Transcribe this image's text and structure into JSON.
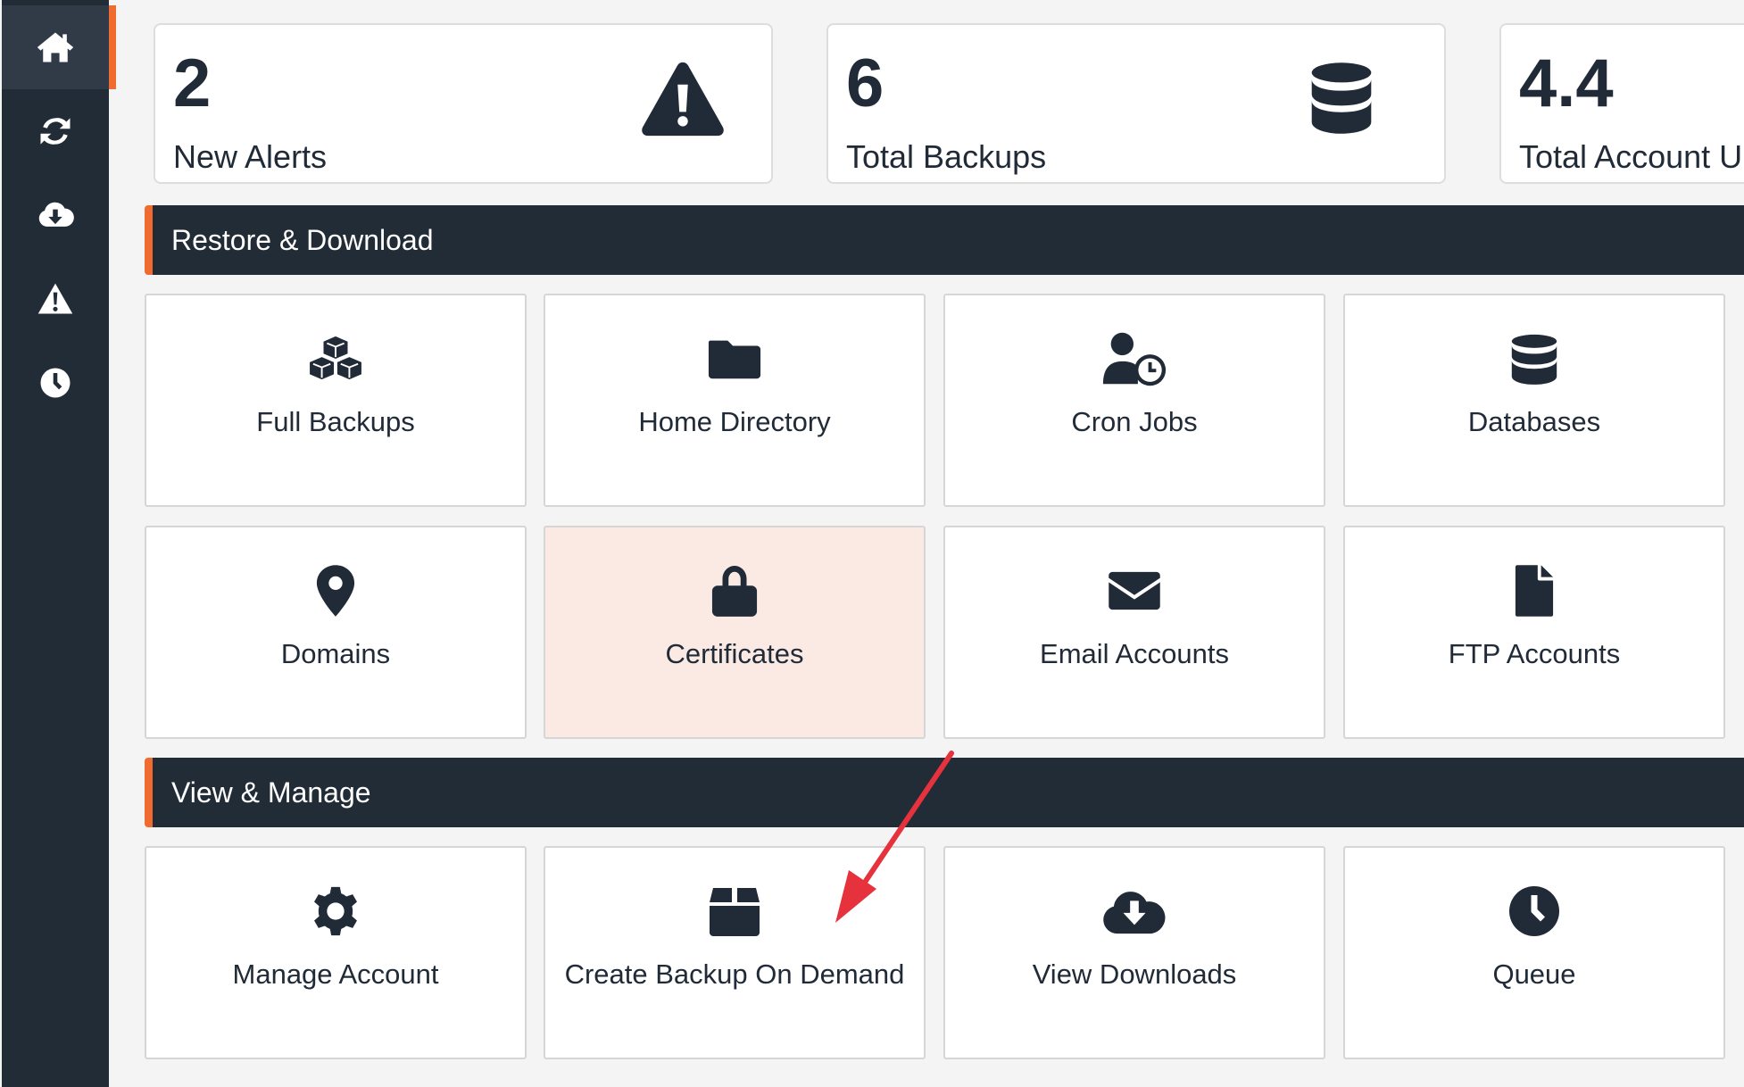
{
  "sidebar": {
    "items": [
      {
        "icon": "home-icon",
        "active": true
      },
      {
        "icon": "sync-icon",
        "active": false
      },
      {
        "icon": "cloud-download-icon",
        "active": false
      },
      {
        "icon": "warning-icon",
        "active": false
      },
      {
        "icon": "clock-icon",
        "active": false
      }
    ]
  },
  "stats": [
    {
      "value": "2",
      "label": "New Alerts",
      "icon": "warning-icon"
    },
    {
      "value": "6",
      "label": "Total Backups",
      "icon": "database-icon"
    },
    {
      "value": "4.4",
      "label": "Total Account U"
    }
  ],
  "sections": {
    "restore": {
      "title": "Restore & Download",
      "tiles": [
        {
          "label": "Full Backups",
          "icon": "cubes-icon"
        },
        {
          "label": "Home Directory",
          "icon": "folder-icon"
        },
        {
          "label": "Cron Jobs",
          "icon": "user-clock-icon"
        },
        {
          "label": "Databases",
          "icon": "database-icon"
        },
        {
          "label": "Domains",
          "icon": "map-marker-icon"
        },
        {
          "label": "Certificates",
          "icon": "lock-icon"
        },
        {
          "label": "Email Accounts",
          "icon": "envelope-icon"
        },
        {
          "label": "FTP Accounts",
          "icon": "file-icon"
        }
      ]
    },
    "manage": {
      "title": "View & Manage",
      "tiles": [
        {
          "label": "Manage Account",
          "icon": "gear-icon"
        },
        {
          "label": "Create Backup On Demand",
          "icon": "box-icon"
        },
        {
          "label": "View Downloads",
          "icon": "cloud-download-icon"
        },
        {
          "label": "Queue",
          "icon": "clock-icon"
        }
      ]
    }
  },
  "colors": {
    "sidebar_bg": "#222c37",
    "accent": "#ef6b2f",
    "text": "#212b38",
    "highlight_tile": "#fbeae3",
    "annotation_arrow": "#e5323c"
  }
}
